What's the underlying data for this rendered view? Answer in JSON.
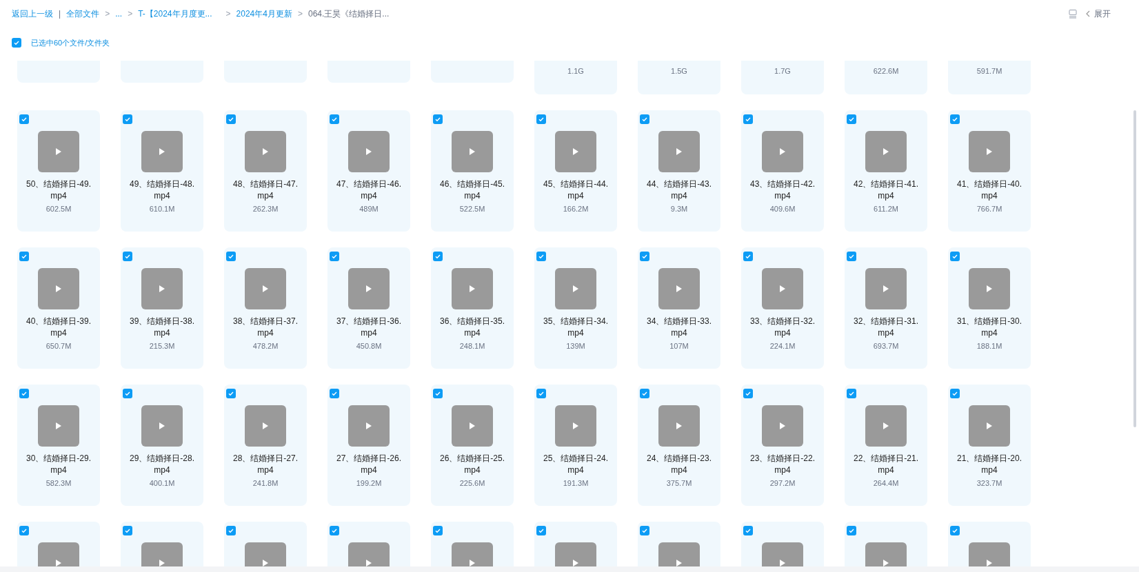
{
  "breadcrumb": {
    "back": "返回上一级",
    "separator": "|",
    "items": [
      {
        "label": "全部文件",
        "current": false
      },
      {
        "label": "...",
        "current": false
      },
      {
        "label": "T-【2024年月度更...",
        "current": false
      },
      {
        "label": "2024年4月更新",
        "current": false
      },
      {
        "label": "064.王昊《结婚择日...",
        "current": true
      }
    ],
    "arrow": ">",
    "expand": "展开"
  },
  "selection": {
    "checked": true,
    "label": "已选中60个文件/文件夹"
  },
  "partial_row": [
    {
      "kind": "blank"
    },
    {
      "kind": "blank"
    },
    {
      "kind": "blank"
    },
    {
      "kind": "blank"
    },
    {
      "kind": "blank"
    },
    {
      "kind": "size",
      "size": "1.1G"
    },
    {
      "kind": "size",
      "size": "1.5G"
    },
    {
      "kind": "size",
      "size": "1.7G"
    },
    {
      "kind": "size",
      "size": "622.6M"
    },
    {
      "kind": "size",
      "size": "591.7M"
    }
  ],
  "rows": [
    [
      {
        "name": "50、结婚择日-49.mp4",
        "size": "602.5M",
        "selected": true
      },
      {
        "name": "49、结婚择日-48.mp4",
        "size": "610.1M",
        "selected": true
      },
      {
        "name": "48、结婚择日-47.mp4",
        "size": "262.3M",
        "selected": true
      },
      {
        "name": "47、结婚择日-46.mp4",
        "size": "489M",
        "selected": true
      },
      {
        "name": "46、结婚择日-45.mp4",
        "size": "522.5M",
        "selected": true
      },
      {
        "name": "45、结婚择日-44.mp4",
        "size": "166.2M",
        "selected": true
      },
      {
        "name": "44、结婚择日-43.mp4",
        "size": "9.3M",
        "selected": true
      },
      {
        "name": "43、结婚择日-42.mp4",
        "size": "409.6M",
        "selected": true
      },
      {
        "name": "42、结婚择日-41.mp4",
        "size": "611.2M",
        "selected": true
      },
      {
        "name": "41、结婚择日-40.mp4",
        "size": "766.7M",
        "selected": true
      }
    ],
    [
      {
        "name": "40、结婚择日-39.mp4",
        "size": "650.7M",
        "selected": true
      },
      {
        "name": "39、结婚择日-38.mp4",
        "size": "215.3M",
        "selected": true
      },
      {
        "name": "38、结婚择日-37.mp4",
        "size": "478.2M",
        "selected": true
      },
      {
        "name": "37、结婚择日-36.mp4",
        "size": "450.8M",
        "selected": true
      },
      {
        "name": "36、结婚择日-35.mp4",
        "size": "248.1M",
        "selected": true
      },
      {
        "name": "35、结婚择日-34.mp4",
        "size": "139M",
        "selected": true
      },
      {
        "name": "34、结婚择日-33.mp4",
        "size": "107M",
        "selected": true
      },
      {
        "name": "33、结婚择日-32.mp4",
        "size": "224.1M",
        "selected": true
      },
      {
        "name": "32、结婚择日-31.mp4",
        "size": "693.7M",
        "selected": true
      },
      {
        "name": "31、结婚择日-30.mp4",
        "size": "188.1M",
        "selected": true
      }
    ],
    [
      {
        "name": "30、结婚择日-29.mp4",
        "size": "582.3M",
        "selected": true
      },
      {
        "name": "29、结婚择日-28.mp4",
        "size": "400.1M",
        "selected": true
      },
      {
        "name": "28、结婚择日-27.mp4",
        "size": "241.8M",
        "selected": true
      },
      {
        "name": "27、结婚择日-26.mp4",
        "size": "199.2M",
        "selected": true
      },
      {
        "name": "26、结婚择日-25.mp4",
        "size": "225.6M",
        "selected": true
      },
      {
        "name": "25、结婚择日-24.mp4",
        "size": "191.3M",
        "selected": true
      },
      {
        "name": "24、结婚择日-23.mp4",
        "size": "375.7M",
        "selected": true
      },
      {
        "name": "23、结婚择日-22.mp4",
        "size": "297.2M",
        "selected": true
      },
      {
        "name": "22、结婚择日-21.mp4",
        "size": "264.4M",
        "selected": true
      },
      {
        "name": "21、结婚择日-20.mp4",
        "size": "323.7M",
        "selected": true
      }
    ],
    [
      {
        "selected": true
      },
      {
        "selected": true
      },
      {
        "selected": true
      },
      {
        "selected": true
      },
      {
        "selected": true
      },
      {
        "selected": true
      },
      {
        "selected": true
      },
      {
        "selected": true
      },
      {
        "selected": true
      },
      {
        "selected": true
      }
    ]
  ]
}
